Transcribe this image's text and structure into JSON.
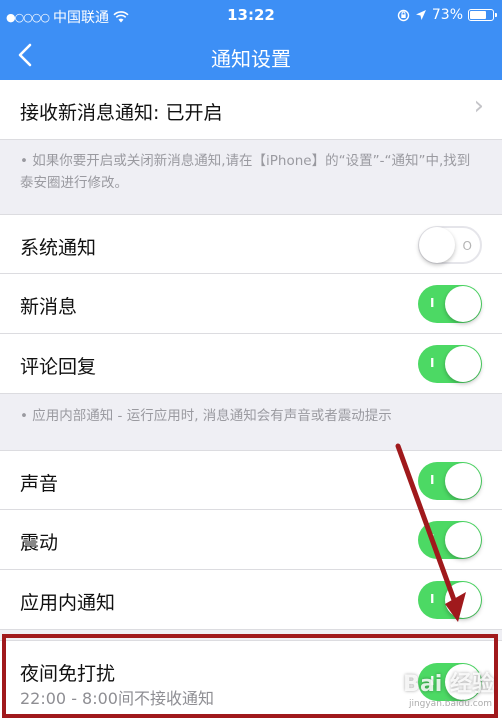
{
  "status_bar": {
    "signal_dots": "●○○○○",
    "carrier": "中国联通",
    "time": "13:22",
    "battery": "73%",
    "battery_level": 0.73
  },
  "nav": {
    "back_icon": "chevron-left",
    "title": "通知设置"
  },
  "receive_row": {
    "label": "接收新消息通知: 已开启",
    "chevron": "›"
  },
  "note_receive": "• 如果你要开启或关闭新消息通知,请在【iPhone】的“设置”-“通知”中,找到泰安圈进行修改。",
  "group1": [
    {
      "label": "系统通知",
      "state": "off"
    },
    {
      "label": "新消息",
      "state": "on"
    },
    {
      "label": "评论回复",
      "state": "on"
    }
  ],
  "note_inapp": "• 应用内部通知 - 运行应用时, 消息通知会有声音或者震动提示",
  "group2": [
    {
      "label": "声音",
      "state": "on"
    },
    {
      "label": "震动",
      "state": "on"
    },
    {
      "label": "应用内通知",
      "state": "on"
    }
  ],
  "night_row": {
    "label": "夜间免打扰",
    "sublabel": "22:00 - 8:00间不接收通知",
    "state": "on"
  },
  "toggle_marks": {
    "on": "I",
    "off": "O"
  },
  "watermark": {
    "main": "Bai 经验",
    "sub": "jingyan.baidu.com"
  },
  "colors": {
    "nav_blue": "#3d8ff5",
    "toggle_green": "#4cd964",
    "highlight_red": "#a0191c",
    "arrow_red": "#a0191c"
  }
}
